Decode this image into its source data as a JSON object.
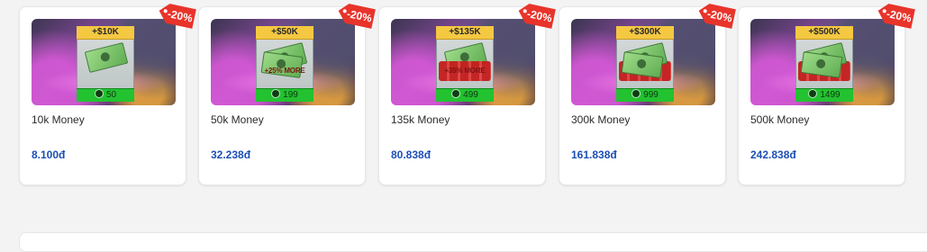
{
  "badge_color": "#e8342b",
  "price_color": "#1b4fb5",
  "products": [
    {
      "title": "10k Money",
      "price": "8.100đ",
      "discount": "-20%",
      "amount": "+$10K",
      "bonus": "",
      "robux": "50"
    },
    {
      "title": "50k Money",
      "price": "32.238đ",
      "discount": "-20%",
      "amount": "+$50K",
      "bonus": "+25% MORE",
      "robux": "199"
    },
    {
      "title": "135k Money",
      "price": "80.838đ",
      "discount": "-20%",
      "amount": "+$135K",
      "bonus": "+35% MORE",
      "robux": "499"
    },
    {
      "title": "300k Money",
      "price": "161.838đ",
      "discount": "-20%",
      "amount": "+$300K",
      "bonus": "",
      "robux": "999"
    },
    {
      "title": "500k Money",
      "price": "242.838đ",
      "discount": "-20%",
      "amount": "+$500K",
      "bonus": "",
      "robux": "1499"
    }
  ]
}
